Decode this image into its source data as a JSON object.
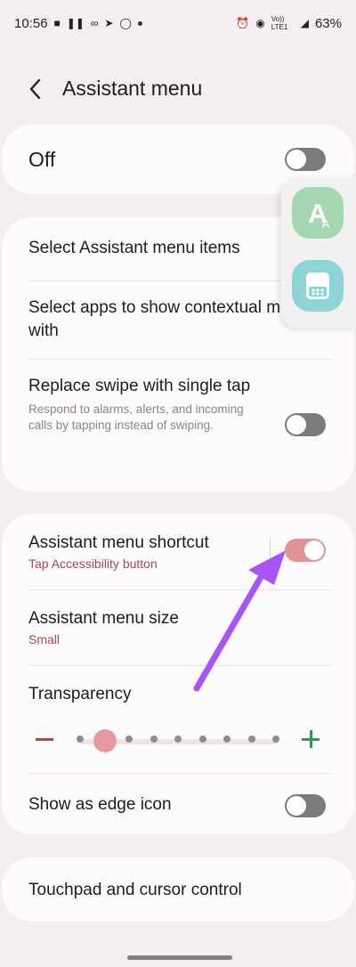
{
  "status_bar": {
    "time": "10:56",
    "battery": "63%",
    "network_label": "Vo)) LTE1",
    "left_icons": [
      "message-icon",
      "pause-icon",
      "voicemail-icon",
      "telegram-icon",
      "sync-icon",
      "dot-icon"
    ],
    "right_icons": [
      "alarm-icon",
      "wifi-icon",
      "signal-icon",
      "battery-icon"
    ]
  },
  "header": {
    "title": "Assistant menu"
  },
  "off_card": {
    "label": "Off",
    "toggle_on": false
  },
  "menu_card": {
    "item1": "Select Assistant menu items",
    "item2": "Select apps to show contextual menus with",
    "item3_title": "Replace swipe with single tap",
    "item3_desc": "Respond to alarms, alerts, and incoming calls by tapping instead of swiping.",
    "item3_toggle_on": false
  },
  "shortcut_card": {
    "shortcut_title": "Assistant menu shortcut",
    "shortcut_sub": "Tap Accessibility button",
    "shortcut_toggle_on": true,
    "size_title": "Assistant menu size",
    "size_value": "Small",
    "transparency_title": "Transparency",
    "transparency_level": 0.125,
    "transparency_steps": 9,
    "edge_title": "Show as edge icon",
    "edge_toggle_on": false
  },
  "bottom_card": {
    "label": "Touchpad and cursor control"
  },
  "floating_menu": {
    "icons": [
      "accessibility-a-icon",
      "assistant-menu-grid-icon"
    ],
    "colors": {
      "green": "#a5d8b0",
      "teal": "#8fd4d4"
    }
  },
  "colors": {
    "accent": "#e39396",
    "accent_text": "#a24a52",
    "arrow": "#a855f7"
  }
}
